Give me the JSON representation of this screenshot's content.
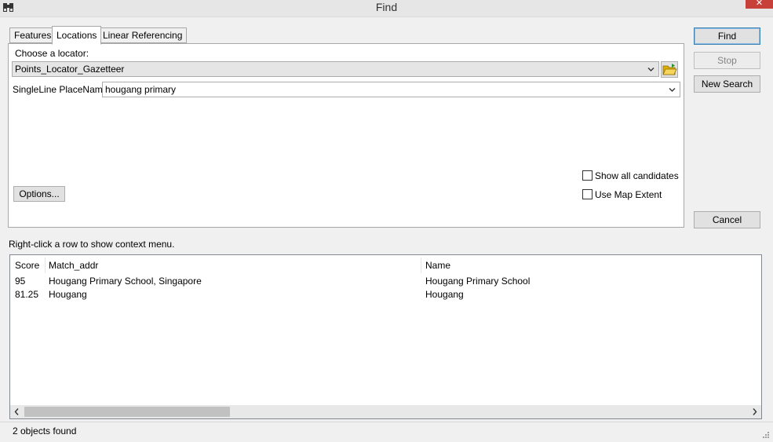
{
  "window": {
    "title": "Find",
    "close_glyph": "✕",
    "app_icon": "binoculars-icon"
  },
  "tabs": [
    {
      "label": "Features",
      "active": false
    },
    {
      "label": "Locations",
      "active": true
    },
    {
      "label": "Linear Referencing",
      "active": false
    }
  ],
  "locations": {
    "choose_locator_label": "Choose a locator:",
    "locator_value": "Points_Locator_Gazetteer",
    "browse_icon": "open-folder-icon",
    "placename_label": "SingleLine PlaceName:",
    "placename_value": "hougang primary",
    "options_button": "Options...",
    "show_all_candidates": {
      "label": "Show all candidates",
      "checked": false
    },
    "use_map_extent": {
      "label": "Use Map Extent",
      "checked": false
    }
  },
  "buttons": {
    "find": "Find",
    "stop": "Stop",
    "new_search": "New Search",
    "cancel": "Cancel"
  },
  "results": {
    "hint": "Right-click a row to show context menu.",
    "columns": [
      "Score",
      "Match_addr",
      "Name"
    ],
    "rows": [
      {
        "score": "95",
        "match_addr": "Hougang Primary School, Singapore",
        "name": "Hougang Primary School"
      },
      {
        "score": "81.25",
        "match_addr": "Hougang",
        "name": "Hougang"
      }
    ]
  },
  "status": {
    "text": "2 objects found"
  },
  "colors": {
    "accent": "#3c7fb1",
    "close_red": "#c7413a",
    "panel_bg": "#f0f0f0"
  }
}
